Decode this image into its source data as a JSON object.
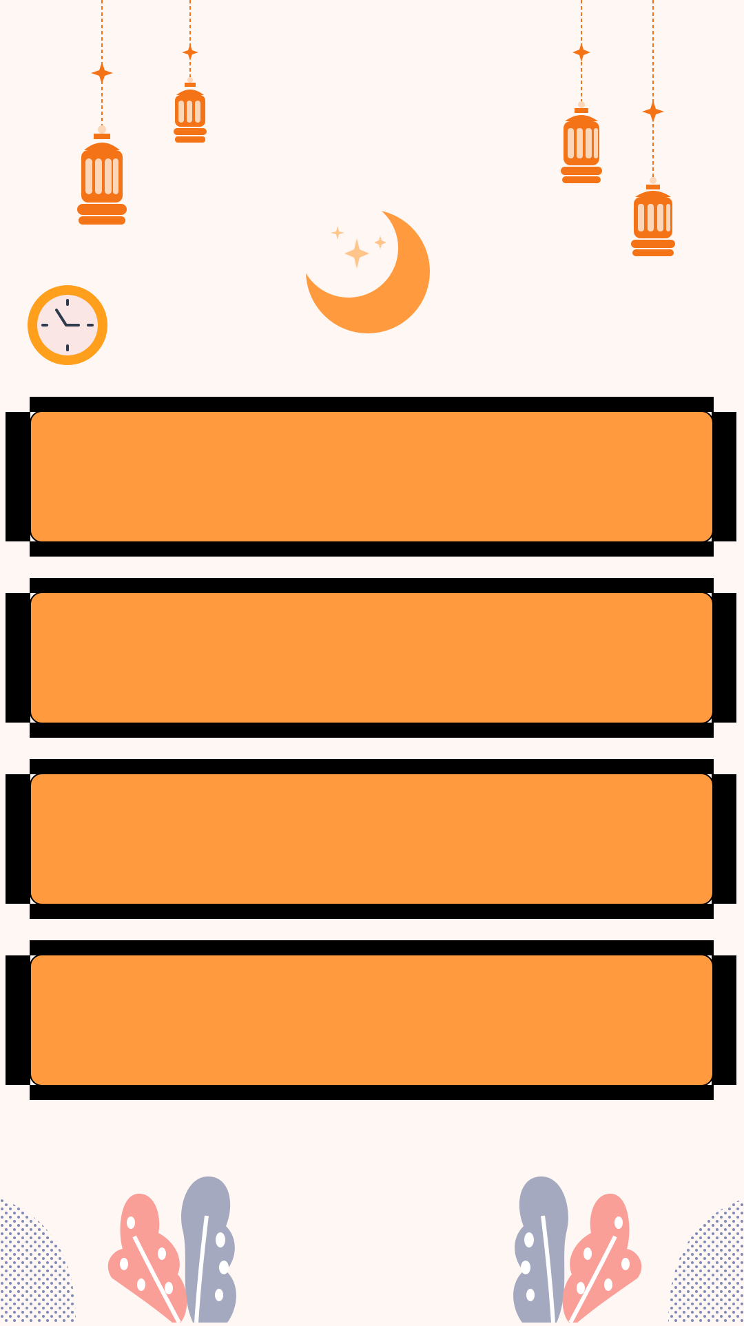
{
  "theme": {
    "background": "#fff7f3",
    "accent_orange": "#ff9a3f",
    "lantern_orange": "#f57317",
    "clock_ring": "#ff9f1c",
    "leaf_pink": "#fa9e98",
    "leaf_gray": "#a4a9bf",
    "dot_blue": "#7f8ab8"
  },
  "icons": {
    "lanterns": [
      "lantern-icon",
      "lantern-icon",
      "lantern-icon",
      "lantern-icon"
    ],
    "moon": "crescent-moon-icon",
    "clock": "clock-icon",
    "leaves": [
      "leaf-icon",
      "leaf-icon",
      "leaf-icon",
      "leaf-icon"
    ]
  },
  "slots": [
    {
      "label": ""
    },
    {
      "label": ""
    },
    {
      "label": ""
    },
    {
      "label": ""
    }
  ]
}
